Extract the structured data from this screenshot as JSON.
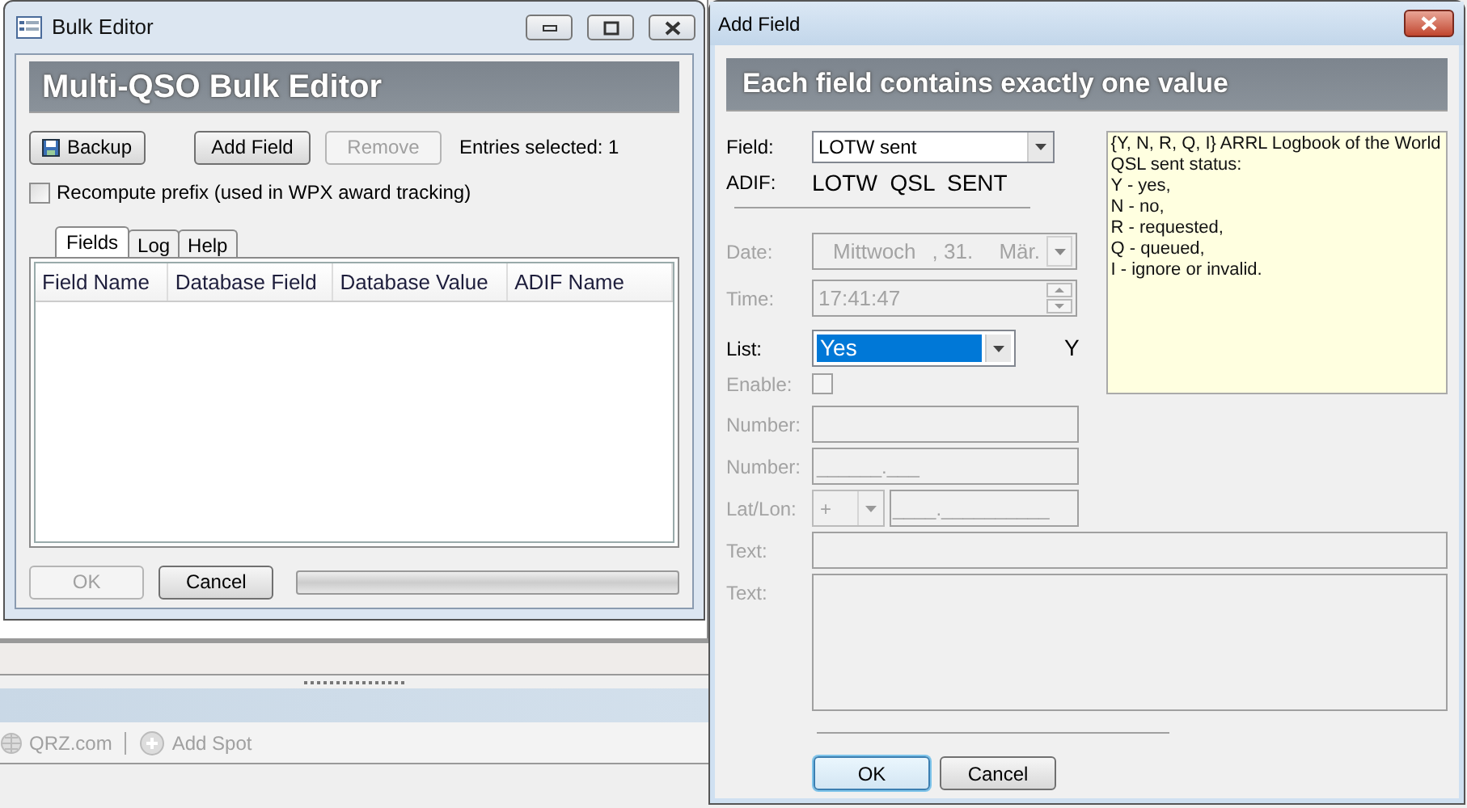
{
  "background_app": {
    "toolbar": [
      {
        "label": "QRZ.com",
        "kind": "globe"
      },
      {
        "label": "Add Spot",
        "kind": "plus"
      }
    ]
  },
  "bulk_editor": {
    "window_title": "Bulk Editor",
    "banner": "Multi-QSO Bulk Editor",
    "buttons": [
      {
        "label": "Backup",
        "kind": "save",
        "disabled": false
      },
      {
        "label": "Add Field",
        "kind": "plain",
        "disabled": false
      },
      {
        "label": "Remove",
        "kind": "plain",
        "disabled": true
      }
    ],
    "entries_selected": "Entries selected: 1",
    "recompute_prefix": {
      "label": "Recompute prefix (used in WPX award tracking)",
      "checked": false
    },
    "tabs": [
      {
        "label": "Fields",
        "selected": true
      },
      {
        "label": "Log",
        "selected": false
      },
      {
        "label": "Help",
        "selected": false
      }
    ],
    "table": {
      "columns": [
        "Field Name",
        "Database Field",
        "Database Value",
        "ADIF Name"
      ]
    },
    "footer_buttons": [
      {
        "label": "OK",
        "disabled": true
      },
      {
        "label": "Cancel",
        "disabled": false
      }
    ],
    "progress": {
      "level": 0
    }
  },
  "add_field": {
    "window_title": "Add Field",
    "banner": "Each field contains exactly one value",
    "rows": [
      {
        "kind": "dropdown",
        "label": "Field:",
        "value": "LOTW sent",
        "disabled": false
      },
      {
        "kind": "adif",
        "label": "ADIF:",
        "value": "LOTW  QSL  SENT",
        "disabled": false
      },
      {
        "kind": "date",
        "label": "Date:",
        "parts": [
          "Mittwoch",
          ", 31.",
          "Mär."
        ],
        "disabled": true
      },
      {
        "kind": "time",
        "label": "Time:",
        "value": "17:41:47",
        "disabled": true
      },
      {
        "kind": "list",
        "label": "List:",
        "value": "Yes",
        "highlighted": true,
        "code": "Y",
        "disabled": false
      },
      {
        "kind": "checkbox",
        "label": "Enable:",
        "checked": false,
        "disabled": true
      },
      {
        "kind": "number",
        "label": "Number:",
        "disabled": true
      },
      {
        "kind": "masked",
        "label": "Number:",
        "value": "______.___",
        "disabled": true
      },
      {
        "kind": "latlon",
        "label": "Lat/Lon:",
        "sign": "+",
        "value": "____.__________",
        "disabled": true
      },
      {
        "kind": "text",
        "label": "Text:",
        "disabled": true
      },
      {
        "kind": "memo",
        "label": "Text:",
        "disabled": true
      }
    ],
    "help_text": [
      "{Y, N, R, Q, I} ARRL Logbook of the World",
      "QSL sent status:",
      "Y - yes,",
      "N - no,",
      "R - requested,",
      "Q - queued,",
      "I - ignore or invalid."
    ],
    "buttons": [
      {
        "label": "OK",
        "focused": true
      },
      {
        "label": "Cancel",
        "focused": false
      }
    ]
  }
}
